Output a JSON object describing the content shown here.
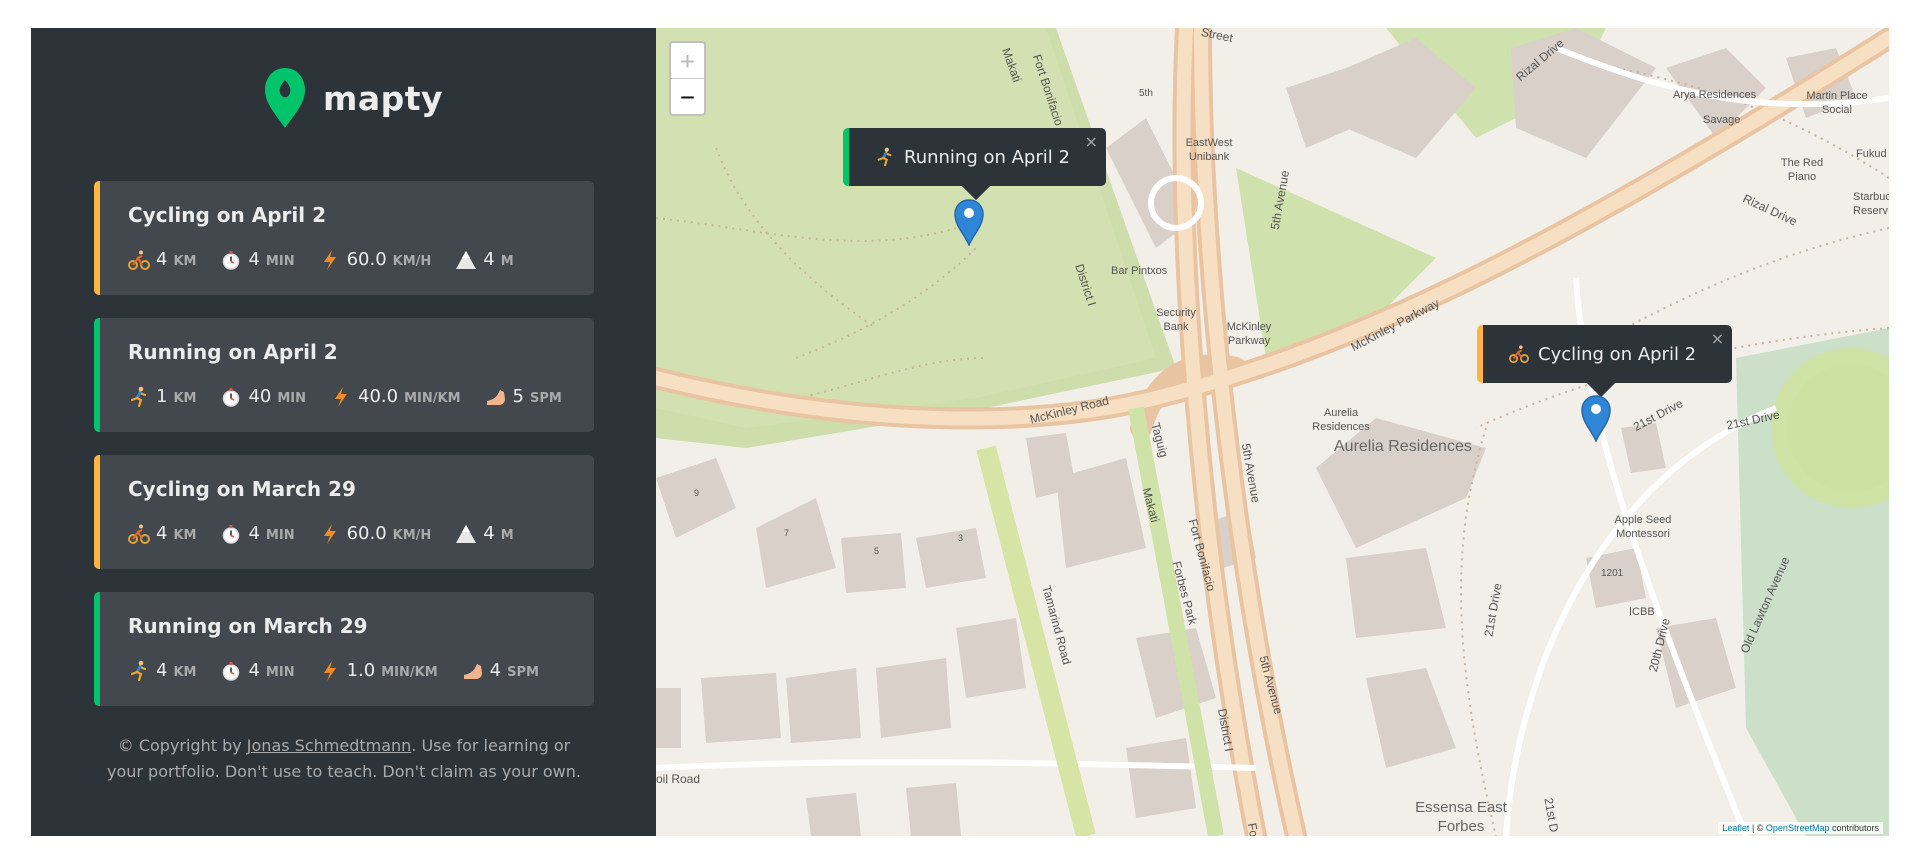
{
  "app": {
    "logo_text": "mapty",
    "brand_color": "#00c46a",
    "cycling_color": "#ffb545",
    "running_color": "#00c46a"
  },
  "workouts": [
    {
      "type": "cycling",
      "title": "Cycling on April 2",
      "stats": [
        {
          "icon": "cyclist-icon",
          "value": "4",
          "unit": "KM"
        },
        {
          "icon": "stopwatch-icon",
          "value": "4",
          "unit": "MIN"
        },
        {
          "icon": "lightning-icon",
          "value": "60.0",
          "unit": "KM/H"
        },
        {
          "icon": "mountain-icon",
          "value": "4",
          "unit": "M"
        }
      ]
    },
    {
      "type": "running",
      "title": "Running on April 2",
      "stats": [
        {
          "icon": "runner-icon",
          "value": "1",
          "unit": "KM"
        },
        {
          "icon": "stopwatch-icon",
          "value": "40",
          "unit": "MIN"
        },
        {
          "icon": "lightning-icon",
          "value": "40.0",
          "unit": "MIN/KM"
        },
        {
          "icon": "foot-icon",
          "value": "5",
          "unit": "SPM"
        }
      ]
    },
    {
      "type": "cycling",
      "title": "Cycling on March 29",
      "stats": [
        {
          "icon": "cyclist-icon",
          "value": "4",
          "unit": "KM"
        },
        {
          "icon": "stopwatch-icon",
          "value": "4",
          "unit": "MIN"
        },
        {
          "icon": "lightning-icon",
          "value": "60.0",
          "unit": "KM/H"
        },
        {
          "icon": "mountain-icon",
          "value": "4",
          "unit": "M"
        }
      ]
    },
    {
      "type": "running",
      "title": "Running on March 29",
      "stats": [
        {
          "icon": "runner-icon",
          "value": "4",
          "unit": "KM"
        },
        {
          "icon": "stopwatch-icon",
          "value": "4",
          "unit": "MIN"
        },
        {
          "icon": "lightning-icon",
          "value": "1.0",
          "unit": "MIN/KM"
        },
        {
          "icon": "foot-icon",
          "value": "4",
          "unit": "SPM"
        }
      ]
    }
  ],
  "copyright": {
    "prefix": "© Copyright by ",
    "author": "Jonas Schmedtmann",
    "suffix": ". Use for learning or your portfolio. Don't use to teach. Don't claim as your own."
  },
  "map": {
    "zoom_in": "+",
    "zoom_out": "−",
    "popups": [
      {
        "type": "running",
        "label": "Running on April 2",
        "close": "×"
      },
      {
        "type": "cycling",
        "label": "Cycling on April 2",
        "close": "×"
      }
    ],
    "attribution": {
      "leaflet": "Leaflet",
      "sep": " | © ",
      "osm": "OpenStreetMap",
      "suffix": " contributors"
    },
    "labels": {
      "street": "Street",
      "rizal_drive_1": "Rizal Drive",
      "rizal_drive_2": "Rizal Drive",
      "makati_1": "Makati",
      "fort_bonifacio_1": "Fort Bonifacio",
      "fifth": "5th",
      "eastwest": "EastWest Unibank",
      "fifth_avenue_1": "5th Avenue",
      "bar_pintxos": "Bar Pintxos",
      "security_bank": "Security Bank",
      "mckinley_parkway_stop": "McKinley Parkway",
      "district_1": "District I",
      "mckinley_parkway": "McKinley Parkway",
      "mckinley_road": "McKinley Road",
      "tagug": "Taguig",
      "fifth_avenue_2": "5th Avenue",
      "aurelia_residences_stop": "Aurelia Residences",
      "aurelia_residences": "Aurelia Residences",
      "arya": "Arya Residences",
      "savage": "Savage",
      "martin_place": "Martin Place Social",
      "red_piano": "The Red Piano",
      "fukuda": "Fukud",
      "starbucks": "Starbuc Reserv",
      "twentyfirst_drive_1": "21st Drive",
      "twentyfirst_drive_2": "21st Drive",
      "apple_seed": "Apple Seed Montessori",
      "n1201": "1201",
      "icbb": "ICBB",
      "twentyfirst_drive_3": "21st Drive",
      "twentieth_drive": "20th Drive",
      "old_lawton": "Old Lawton Avenue",
      "makati_2": "Makati",
      "fort_bonifacio_2": "Fort Bonifacio",
      "forbes_park": "Forbes Park",
      "tamarind_road": "Tamarind Road",
      "district_2": "District I",
      "fifth_avenue_3": "5th Avenue",
      "essensa": "Essensa East Forbes",
      "twentyfirst_drive_4": "21st D",
      "oil_road": "oil Road",
      "fo": "Fo",
      "n9": "9",
      "n7": "7",
      "n5": "5",
      "n3": "3"
    }
  }
}
